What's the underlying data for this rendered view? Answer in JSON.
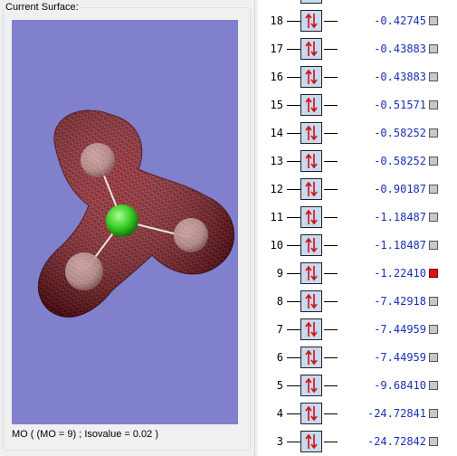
{
  "surface_panel": {
    "title": "Current Surface:",
    "status": "MO ( (MO = 9) ; Isovalue = 0.02 )"
  },
  "mo_list": {
    "rows": [
      {
        "number": "18",
        "energy": "-0.42745",
        "selected": false
      },
      {
        "number": "17",
        "energy": "-0.43883",
        "selected": false
      },
      {
        "number": "16",
        "energy": "-0.43883",
        "selected": false
      },
      {
        "number": "15",
        "energy": "-0.51571",
        "selected": false
      },
      {
        "number": "14",
        "energy": "-0.58252",
        "selected": false
      },
      {
        "number": "13",
        "energy": "-0.58252",
        "selected": false
      },
      {
        "number": "12",
        "energy": "-0.90187",
        "selected": false
      },
      {
        "number": "11",
        "energy": "-1.18487",
        "selected": false
      },
      {
        "number": "10",
        "energy": "-1.18487",
        "selected": false
      },
      {
        "number": "9",
        "energy": "-1.22410",
        "selected": true
      },
      {
        "number": "8",
        "energy": "-7.42918",
        "selected": false
      },
      {
        "number": "7",
        "energy": "-7.44959",
        "selected": false
      },
      {
        "number": "6",
        "energy": "-7.44959",
        "selected": false
      },
      {
        "number": "5",
        "energy": "-9.68410",
        "selected": false
      },
      {
        "number": "4",
        "energy": "-24.72841",
        "selected": false
      },
      {
        "number": "3",
        "energy": "-24.72842",
        "selected": false
      }
    ]
  },
  "colors": {
    "viewport_bg": "#8080cc",
    "isosurface": "#7a1010",
    "central_atom": "#33cc22",
    "outer_atoms": "#ffffff",
    "energy_text": "#1a2fb5",
    "selected_marker": "#e01010",
    "orbital_box": "#c9d9f0",
    "electron_arrow": "#d01010"
  },
  "icons": {
    "electron_pair": "up-down-arrows-icon"
  }
}
